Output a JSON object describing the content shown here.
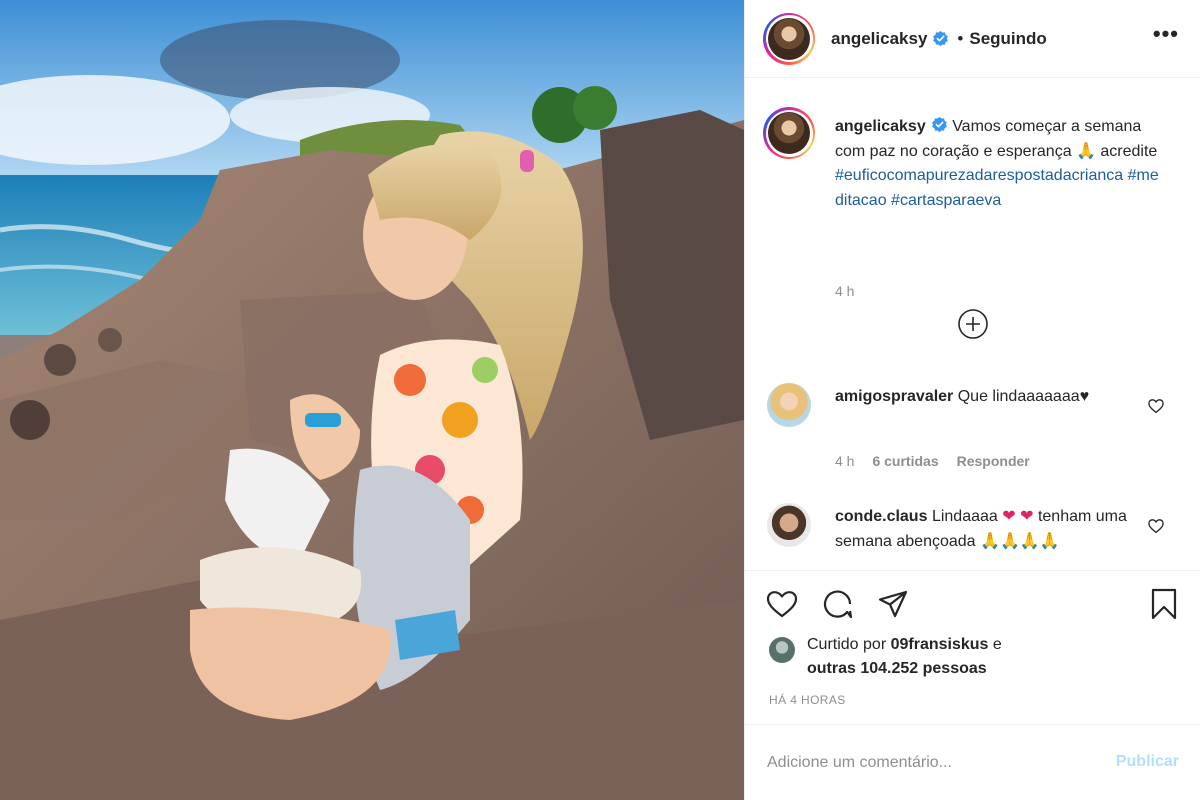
{
  "post": {
    "author": "angelicaksy",
    "follow_state": "Seguindo",
    "separator": "•",
    "more_label": "•••"
  },
  "caption": {
    "author": "angelicaksy",
    "text": "Vamos começar a semana com paz no coração e esperança 🙏 acredite",
    "hashtags": "#euficocomapurezadarespostadacrianca #meditacao #cartasparaeva",
    "time": "4 h"
  },
  "comments": [
    {
      "user": "amigospravaler",
      "text": "Que lindaaaaaaa",
      "emoji": "♥",
      "time": "4 h",
      "likes": "6 curtidas",
      "reply_label": "Responder"
    },
    {
      "user": "conde.claus",
      "text": "Lindaaaa",
      "emoji": "❤ ❤",
      "text2": "tenham uma semana abençoada",
      "emoji2": "🙏🙏🙏🙏"
    }
  ],
  "likes": {
    "prefix": "Curtido por",
    "user": "09fransiskus",
    "conj": "e",
    "others": "outras 104.252 pessoas"
  },
  "posted_ago": "HÁ 4 HORAS",
  "add_comment": {
    "placeholder": "Adicione um comentário...",
    "publish_label": "Publicar"
  },
  "icons": [
    "more-icon",
    "verified-icon",
    "add-circle-icon",
    "heart-icon",
    "comment-icon",
    "share-icon",
    "bookmark-icon"
  ],
  "colors": {
    "hashtag": "#1d5da1",
    "verified": "#3897f0",
    "publish_disabled": "#b2dffc",
    "muted": "#8e8e8e"
  }
}
